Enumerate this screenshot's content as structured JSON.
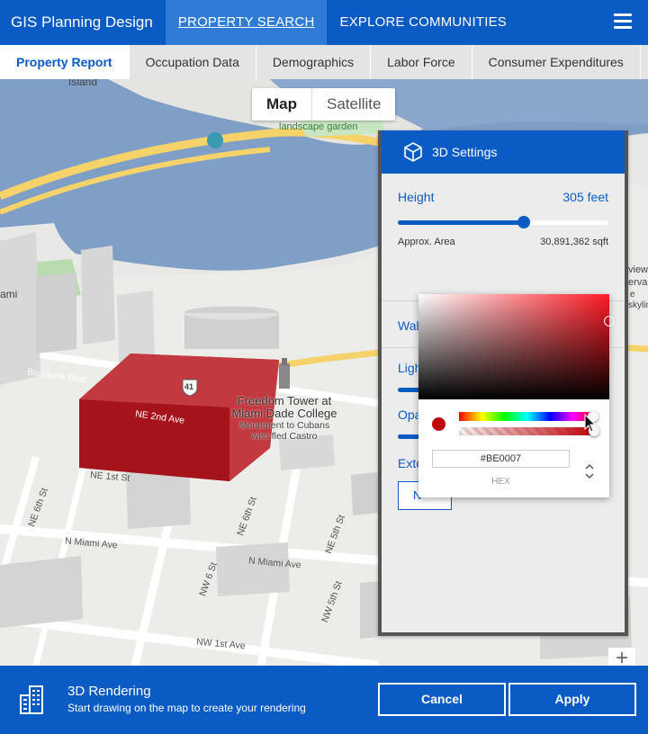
{
  "nav": {
    "brand": "GIS Planning Design",
    "items": [
      "PROPERTY SEARCH",
      "EXPLORE COMMUNITIES"
    ]
  },
  "tabs": [
    "Property Report",
    "Occupation Data",
    "Demographics",
    "Labor Force",
    "Consumer Expenditures"
  ],
  "map": {
    "toggle": {
      "map": "Map",
      "satellite": "Satellite"
    },
    "labels": {
      "island": "Island",
      "garden": "landscape garden",
      "shield": "41",
      "tower_title_1": "Freedom Tower at",
      "tower_title_2": "Miami Dade College",
      "tower_sub_1": "Monument to Cubans",
      "tower_sub_2": "who fled Castro",
      "left_cut": "ami",
      "right_cut_1": "view",
      "right_cut_2": "erva",
      "right_cut_3": "e",
      "right_cut_4": "skylin"
    },
    "streets": {
      "s1": "NE 2nd Ave",
      "s2": "NE 1st St",
      "s3": "N Miami Ave",
      "s4": "NE 6th St",
      "s5": "NE 5th St",
      "s6": "N Miami Ave",
      "s7": "NW 6 St",
      "s8": "NW 5th St",
      "s9": "NW 1st Ave",
      "s10": "NE 6th St",
      "s11": "Biscayne Blvd"
    }
  },
  "settings": {
    "title": "3D Settings",
    "height_label": "Height",
    "height_value": "305 feet",
    "height_fraction": 0.6,
    "area_label": "Approx. Area",
    "area_value": "30,891,362 sqft",
    "wall_color_label": "Wall Color",
    "wall_color": "#be0007",
    "light_label": "Ligh",
    "opacity_label": "Opa",
    "extent_label": "Exte",
    "extent_button": "N"
  },
  "picker": {
    "hex": "#BE0007",
    "mode_label": "HEX",
    "hue_fraction": 0.98,
    "alpha_fraction": 1.0
  },
  "bottom": {
    "title": "3D Rendering",
    "subtitle": "Start drawing on the map to create your rendering",
    "cancel": "Cancel",
    "apply": "Apply"
  },
  "colors": {
    "primary": "#0a5bc4",
    "building": "#be0007"
  }
}
